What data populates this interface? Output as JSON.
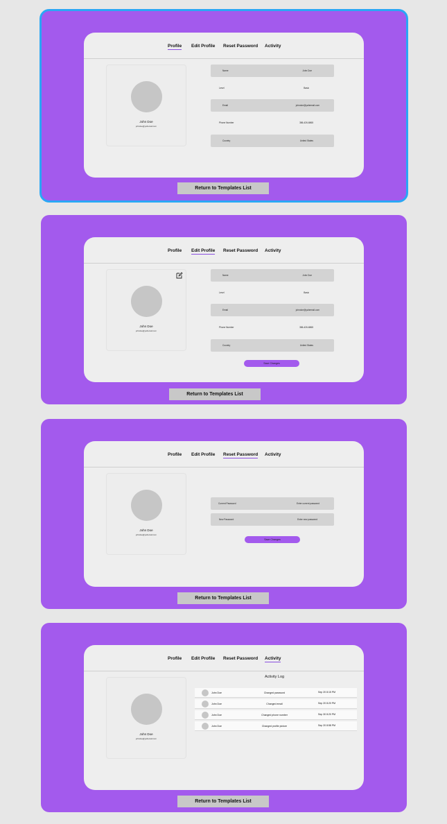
{
  "tabs": [
    "Profile",
    "Edit Profile",
    "Reset Password",
    "Activity"
  ],
  "user": {
    "name": "John Doe",
    "email": "johndoe@yahemail.com"
  },
  "profile_rows": [
    {
      "label": "Name",
      "value": "John Doe"
    },
    {
      "label": "Level",
      "value": "Basic"
    },
    {
      "label": "Email",
      "value": "johndoe@yahemail.com"
    },
    {
      "label": "Phone Number",
      "value": "386-426-6865"
    },
    {
      "label": "Country",
      "value": "United States"
    }
  ],
  "edit_rows": [
    {
      "label": "Name",
      "value": "John Doe"
    },
    {
      "label": "Level",
      "value": "Basic"
    },
    {
      "label": "Email",
      "value": "johndoe@yahemail.com"
    },
    {
      "label": "Phone Number",
      "value": "386-426-6865"
    },
    {
      "label": "Country",
      "value": "United States"
    }
  ],
  "password_rows": [
    {
      "label": "Current Password",
      "placeholder": "Enter current password"
    },
    {
      "label": "New Password",
      "placeholder": "Enter new password"
    }
  ],
  "save_label": "Save Changes",
  "return_label": "Return to Templates List",
  "activity": {
    "title": "Activity Log",
    "rows": [
      {
        "user": "John Doe",
        "action": "Changed password",
        "time": "Sep 20 8:15 PM"
      },
      {
        "user": "John Doe",
        "action": "Changed email",
        "time": "Sep 20 8:20 PM"
      },
      {
        "user": "John Doe",
        "action": "Changed phone number",
        "time": "Sep 30 8:20 PM"
      },
      {
        "user": "John Doe",
        "action": "Changed profile picture",
        "time": "Sep 20 8:58 PM"
      }
    ]
  },
  "colors": {
    "frame": "#a35aed",
    "selection": "#2aa7f5",
    "card": "#eeeeee",
    "row": "#d3d3d3"
  }
}
